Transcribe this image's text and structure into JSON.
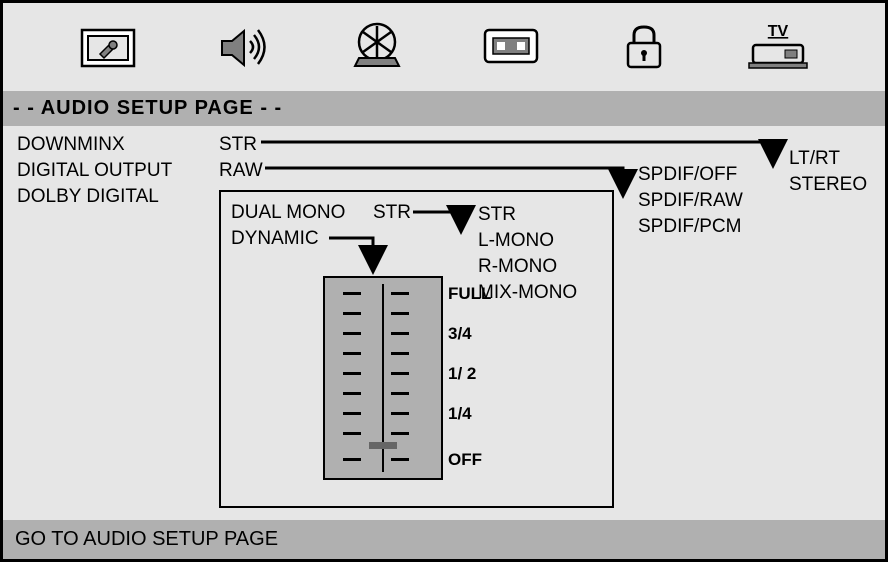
{
  "title": "- -  AUDIO SETUP PAGE  - -",
  "menu": {
    "items": [
      "DOWNMINX",
      "DIGITAL OUTPUT",
      "DOLBY DIGITAL"
    ],
    "values": [
      "STR",
      "RAW",
      ""
    ]
  },
  "dolby": {
    "dual_mono_label": "DUAL MONO",
    "dual_mono_value": "STR",
    "dynamic_label": "DYNAMIC",
    "mono_options": [
      "STR",
      "L-MONO",
      "R-MONO",
      "MIX-MONO"
    ],
    "slider_labels": [
      "FULL",
      "3/4",
      "1/ 2",
      "1/4",
      "OFF"
    ]
  },
  "digital_output_options": [
    "SPDIF/OFF",
    "SPDIF/RAW",
    "SPDIF/PCM"
  ],
  "downmix_options": [
    "LT/RT",
    "STEREO"
  ],
  "footer": "GO TO AUDIO SETUP PAGE",
  "icons": {
    "general": "general-icon",
    "audio": "audio-icon",
    "video": "video-icon",
    "preference": "preference-icon",
    "lock": "lock-icon",
    "tv": "tv-icon",
    "tv_label": "TV"
  }
}
